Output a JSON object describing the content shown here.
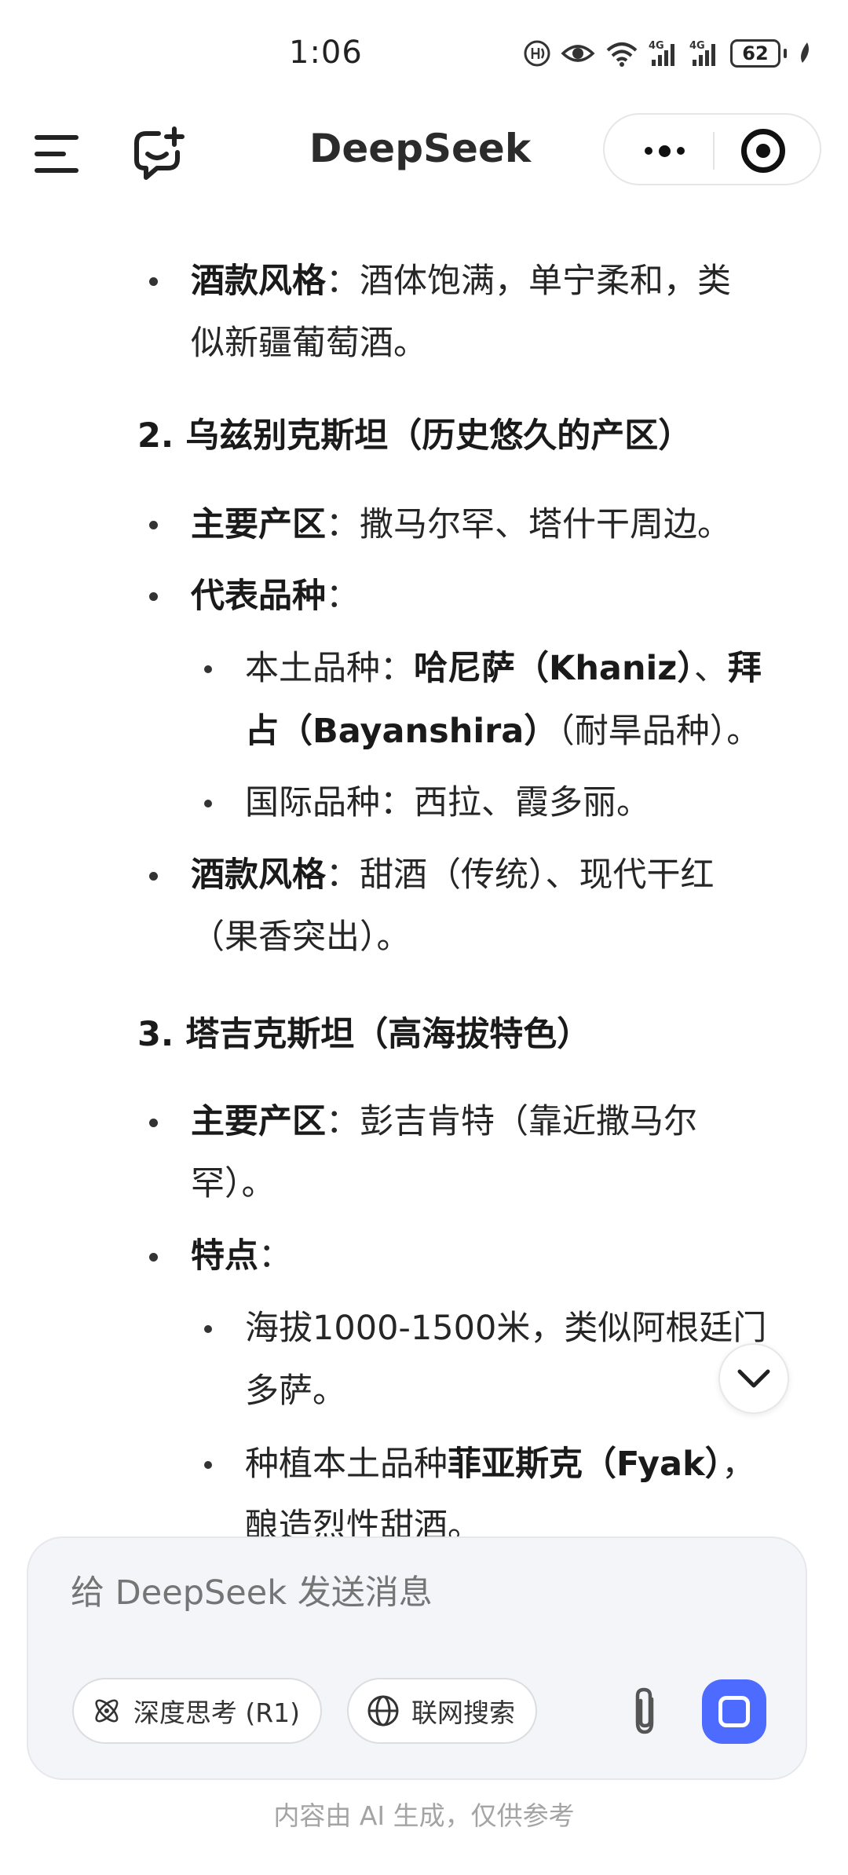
{
  "status_bar": {
    "time": "1:06",
    "battery": "62"
  },
  "header": {
    "title": "DeepSeek"
  },
  "content": {
    "l1_label": "酒款风格",
    "l1_text": "：酒体饱满，单宁柔和，类",
    "l1_cont": "似新疆葡萄酒。",
    "h2": "2. 乌兹别克斯坦（历史悠久的产区）",
    "l2_label": "主要产区",
    "l2_text": "：撒马尔罕、塔什干周边。",
    "l3_label": "代表品种",
    "l3_text": "：",
    "s1_text": "本土品种：",
    "s1_bold": "哈尼萨（Khaniz）",
    "s1_sep": "、",
    "s1_bold2": "拜",
    "s1_cont_bold": "占（Bayanshira）",
    "s1_cont_text": "（耐旱品种）。",
    "s2_text": "国际品种：西拉、霞多丽。",
    "l4_label": "酒款风格",
    "l4_text": "：甜酒（传统）、现代干红",
    "l4_cont": "（果香突出）。",
    "h3": "3. 塔吉克斯坦（高海拔特色）",
    "l5_label": "主要产区",
    "l5_text": "：彭吉肯特（靠近撒马尔",
    "l5_cont": "罕）。",
    "l6_label": "特点",
    "l6_text": "：",
    "s3_text": "海拔1000-1500米，类似阿根廷门",
    "s3_cont": "多萨。",
    "s4_text": "种植本土品种",
    "s4_bold": "菲亚斯克（Fyak）",
    "s4_tail": "，",
    "s4_cont": "酿造烈性甜酒。"
  },
  "composer": {
    "placeholder": "给 DeepSeek 发送消息",
    "deep_think_label": "深度思考 (R1)",
    "web_search_label": "联网搜索"
  },
  "footer_note": "内容由 AI 生成，仅供参考",
  "colors": {
    "accent": "#4d6bfe",
    "composer_bg": "#f4f5f8"
  }
}
